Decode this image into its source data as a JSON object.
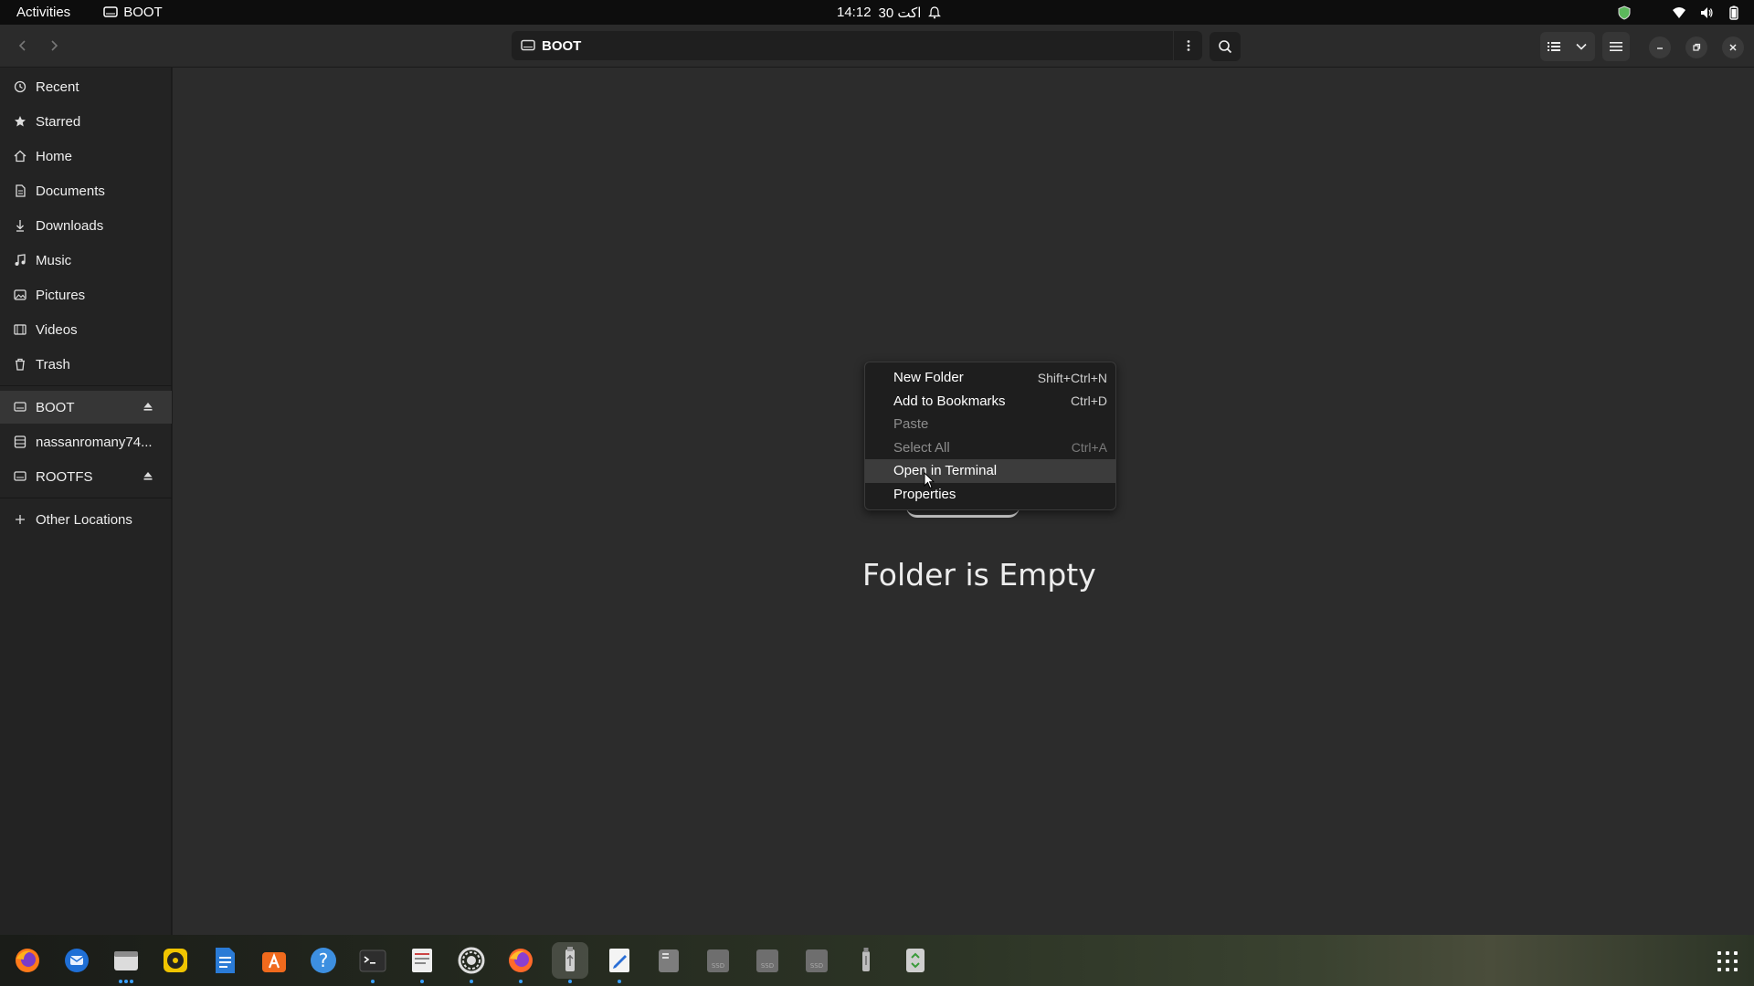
{
  "topbar": {
    "activities": "Activities",
    "app_name": "BOOT",
    "time": "14:12",
    "date": "30 اکت"
  },
  "header": {
    "path_label": "BOOT"
  },
  "sidebar": {
    "items": [
      {
        "label": "Recent",
        "icon": "clock-icon"
      },
      {
        "label": "Starred",
        "icon": "star-icon"
      },
      {
        "label": "Home",
        "icon": "home-icon"
      },
      {
        "label": "Documents",
        "icon": "document-icon"
      },
      {
        "label": "Downloads",
        "icon": "download-icon"
      },
      {
        "label": "Music",
        "icon": "music-icon"
      },
      {
        "label": "Pictures",
        "icon": "picture-icon"
      },
      {
        "label": "Videos",
        "icon": "video-icon"
      },
      {
        "label": "Trash",
        "icon": "trash-icon"
      }
    ],
    "devices": [
      {
        "label": "BOOT",
        "icon": "drive-icon",
        "ejectable": true,
        "active": true
      },
      {
        "label": "nassanromany74...",
        "icon": "server-icon",
        "ejectable": false
      },
      {
        "label": "ROOTFS",
        "icon": "drive-icon",
        "ejectable": true
      }
    ],
    "other_locations": "Other Locations"
  },
  "main": {
    "empty_message": "Folder is Empty"
  },
  "context_menu": {
    "items": [
      {
        "label": "New Folder",
        "shortcut": "Shift+Ctrl+N",
        "enabled": true
      },
      {
        "label": "Add to Bookmarks",
        "shortcut": "Ctrl+D",
        "enabled": true
      },
      {
        "label": "Paste",
        "shortcut": "",
        "enabled": false
      },
      {
        "label": "Select All",
        "shortcut": "Ctrl+A",
        "enabled": false
      },
      {
        "label": "Open in Terminal",
        "shortcut": "",
        "enabled": true,
        "hover": true
      },
      {
        "label": "Properties",
        "shortcut": "",
        "enabled": true
      }
    ]
  },
  "dock": {
    "apps": [
      "firefox-icon",
      "thunderbird-icon",
      "files-icon",
      "rhythmbox-icon",
      "writer-icon",
      "software-icon",
      "help-icon",
      "terminal-icon",
      "document-viewer-icon",
      "settings-icon",
      "firefox-alt-icon",
      "usb-drive-icon",
      "text-editor-icon",
      "disk-icon",
      "ssd-icon",
      "ssd-icon",
      "ssd-icon",
      "usb-icon",
      "trash-icon"
    ]
  }
}
